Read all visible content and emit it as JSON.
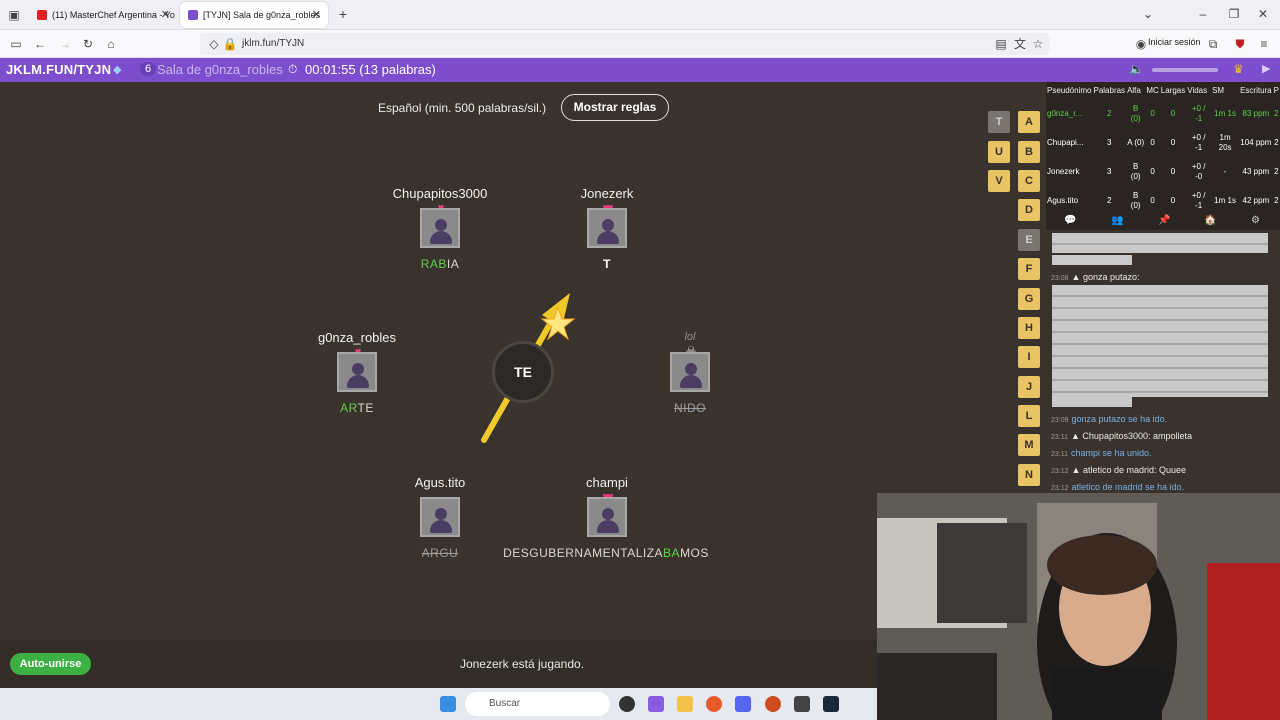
{
  "browser": {
    "tabs": [
      {
        "title": "(11) MasterChef Argentina - Yo",
        "icon_color": "#e02020"
      },
      {
        "title": "[TYJN] Sala de g0nza_robles",
        "icon_color": "#7c4dcc"
      }
    ],
    "url": "jklm.fun/TYJN",
    "signin_label": "Iniciar sesión"
  },
  "gamebar": {
    "room_title": "JKLM.FUN/TYJN",
    "player_count": "6",
    "room_name": "Sala de g0nza_robles",
    "timer": "00:01:55 (13 palabras)"
  },
  "game": {
    "dictionary_label": "Español (min. 500 palabras/sil.)",
    "rules_button": "Mostrar reglas",
    "syllable": "TE",
    "autojoin_button": "Auto-unirse",
    "status_text": "Jonezerk está jugando.",
    "players": [
      {
        "name": "Chupapitos3000",
        "lives": 1,
        "word_hl": "RAB",
        "word_rest": "IA",
        "dead": false
      },
      {
        "name": "Jonezerk",
        "lives": 2,
        "word_hl": "",
        "word_rest": "T",
        "dead": false
      },
      {
        "name": "g0nza_robles",
        "lives": 1,
        "word_hl": "AR",
        "word_rest": "TE",
        "dead": false
      },
      {
        "name": "lol",
        "lives": 0,
        "word_hl": "",
        "word_rest": "NIDO",
        "dead": true
      },
      {
        "name": "Agus.tito",
        "lives": 0,
        "word_hl": "",
        "word_rest": "ARGU",
        "dead": true
      },
      {
        "name": "champi",
        "lives": 2,
        "word_pre": "DESGUBERNAMENTALIZA",
        "word_hl": "BA",
        "word_rest": "MOS",
        "dead": false
      }
    ],
    "letters_left_column": [
      "T",
      "U",
      "V"
    ],
    "letters_right_column": [
      "A",
      "B",
      "C",
      "D",
      "E",
      "F",
      "G",
      "H",
      "I",
      "J",
      "L",
      "M",
      "N"
    ],
    "unused_letters": [
      "T",
      "E"
    ],
    "heart_glyph": "♥",
    "skull_glyph": "☠"
  },
  "scoreboard": {
    "headers": [
      "Pseudónimo",
      "Palabras",
      "Alfa",
      "MC",
      "Largas",
      "Vidas",
      "SM",
      "Escritura",
      "P"
    ],
    "rows": [
      [
        "g0nza_r...",
        "2",
        "B (0)",
        "0",
        "0",
        "+0 / -1",
        "1m 1s",
        "83 ppm",
        "2"
      ],
      [
        "Chupapi...",
        "3",
        "A (0)",
        "0",
        "0",
        "+0 / -1",
        "1m 20s",
        "104 ppm",
        "2"
      ],
      [
        "Jonezerk",
        "3",
        "B (0)",
        "0",
        "0",
        "+0 / -0",
        "-",
        "43 ppm",
        "2"
      ],
      [
        "Agus.tito",
        "2",
        "B (0)",
        "0",
        "0",
        "+0 / -1",
        "1m 1s",
        "42 ppm",
        "2"
      ]
    ]
  },
  "chat": {
    "messages": [
      {
        "time": "23:08",
        "author": "gonza putazo:",
        "text": "",
        "system": false
      },
      {
        "time": "23:09",
        "author": "",
        "text": "gonza putazo se ha ido.",
        "system": true
      },
      {
        "time": "23:11",
        "author": "Chupapitos3000:",
        "text": "ampolleta",
        "system": false
      },
      {
        "time": "23:11",
        "author": "",
        "text": "champi se ha unido.",
        "system": true
      },
      {
        "time": "23:12",
        "author": "atletico de madrid:",
        "text": "Quuee",
        "system": false
      },
      {
        "time": "23:12",
        "author": "",
        "text": "atletico de madrid se ha ido.",
        "system": true
      }
    ]
  },
  "taskbar": {
    "search_placeholder": "Buscar"
  }
}
